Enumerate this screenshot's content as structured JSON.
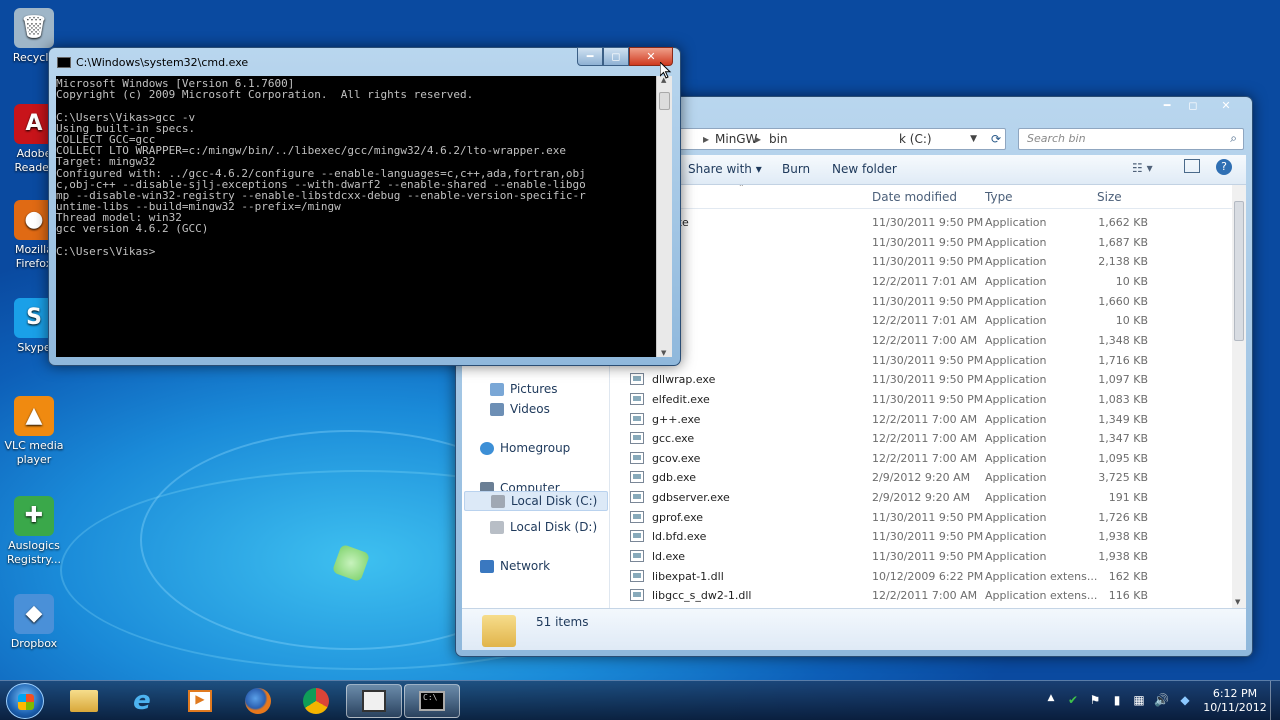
{
  "desktop": {
    "icons": [
      {
        "label": "Recycle",
        "glyph": "🗑",
        "color": "#9fb6c8"
      },
      {
        "label": "Adobe Reader",
        "glyph": "A",
        "color": "#c8141a"
      },
      {
        "label": "Mozilla Firefox",
        "glyph": "●",
        "color": "#e06a14"
      },
      {
        "label": "Skype",
        "glyph": "S",
        "color": "#1aa0e8"
      },
      {
        "label": "VLC media player",
        "glyph": "▲",
        "color": "#f08a10"
      },
      {
        "label": "Auslogics Registry...",
        "glyph": "✚",
        "color": "#3aa84a"
      },
      {
        "label": "Dropbox",
        "glyph": "◆",
        "color": "#4a90d8"
      }
    ]
  },
  "cmd": {
    "title": "C:\\Windows\\system32\\cmd.exe",
    "lines": [
      "Microsoft Windows [Version 6.1.7600]",
      "Copyright (c) 2009 Microsoft Corporation.  All rights reserved.",
      "",
      "C:\\Users\\Vikas>gcc -v",
      "Using built-in specs.",
      "COLLECT_GCC=gcc",
      "COLLECT_LTO_WRAPPER=c:/mingw/bin/../libexec/gcc/mingw32/4.6.2/lto-wrapper.exe",
      "Target: mingw32",
      "Configured with: ../gcc-4.6.2/configure --enable-languages=c,c++,ada,fortran,obj",
      "c,obj-c++ --disable-sjlj-exceptions --with-dwarf2 --enable-shared --enable-libgo",
      "mp --disable-win32-registry --enable-libstdcxx-debug --enable-version-specific-r",
      "untime-libs --build=mingw32 --prefix=/mingw",
      "Thread model: win32",
      "gcc version 4.6.2 (GCC)",
      "",
      "C:\\Users\\Vikas>"
    ]
  },
  "explorer": {
    "address": [
      "k (C:)",
      "MinGW",
      "bin"
    ],
    "search_placeholder": "Search bin",
    "toolbar": {
      "share": "Share with",
      "burn": "Burn",
      "new_folder": "New folder"
    },
    "columns": {
      "date": "Date modified",
      "type": "Type",
      "size": "Size"
    },
    "nav": [
      {
        "label": "Pictures",
        "color": "#7aa7d6"
      },
      {
        "label": "Videos",
        "color": "#6d8fb5"
      },
      {
        "label": "Homegroup",
        "color": "#3d8fd6"
      },
      {
        "label": "Computer",
        "color": "#6b7f95"
      },
      {
        "label": "Local Disk (C:)",
        "color": "#a0a8b3"
      },
      {
        "label": "Local Disk (D:)",
        "color": "#b8bec6"
      },
      {
        "label": "Network",
        "color": "#3a78c0"
      }
    ],
    "files": [
      {
        "name": "ne.exe",
        "date": "11/30/2011 9:50 PM",
        "type": "Application",
        "size": "1,662 KB"
      },
      {
        "name": "",
        "date": "11/30/2011 9:50 PM",
        "type": "Application",
        "size": "1,687 KB"
      },
      {
        "name": "",
        "date": "11/30/2011 9:50 PM",
        "type": "Application",
        "size": "2,138 KB"
      },
      {
        "name": "e",
        "date": "12/2/2011 7:01 AM",
        "type": "Application",
        "size": "10 KB"
      },
      {
        "name": ".exe",
        "date": "11/30/2011 9:50 PM",
        "type": "Application",
        "size": "1,660 KB"
      },
      {
        "name": "",
        "date": "12/2/2011 7:01 AM",
        "type": "Application",
        "size": "10 KB"
      },
      {
        "name": "e",
        "date": "12/2/2011 7:00 AM",
        "type": "Application",
        "size": "1,348 KB"
      },
      {
        "name": ".exe",
        "date": "11/30/2011 9:50 PM",
        "type": "Application",
        "size": "1,716 KB"
      },
      {
        "name": "dllwrap.exe",
        "date": "11/30/2011 9:50 PM",
        "type": "Application",
        "size": "1,097 KB"
      },
      {
        "name": "elfedit.exe",
        "date": "11/30/2011 9:50 PM",
        "type": "Application",
        "size": "1,083 KB"
      },
      {
        "name": "g++.exe",
        "date": "12/2/2011 7:00 AM",
        "type": "Application",
        "size": "1,349 KB"
      },
      {
        "name": "gcc.exe",
        "date": "12/2/2011 7:00 AM",
        "type": "Application",
        "size": "1,347 KB"
      },
      {
        "name": "gcov.exe",
        "date": "12/2/2011 7:00 AM",
        "type": "Application",
        "size": "1,095 KB"
      },
      {
        "name": "gdb.exe",
        "date": "2/9/2012 9:20 AM",
        "type": "Application",
        "size": "3,725 KB"
      },
      {
        "name": "gdbserver.exe",
        "date": "2/9/2012 9:20 AM",
        "type": "Application",
        "size": "191 KB"
      },
      {
        "name": "gprof.exe",
        "date": "11/30/2011 9:50 PM",
        "type": "Application",
        "size": "1,726 KB"
      },
      {
        "name": "ld.bfd.exe",
        "date": "11/30/2011 9:50 PM",
        "type": "Application",
        "size": "1,938 KB"
      },
      {
        "name": "ld.exe",
        "date": "11/30/2011 9:50 PM",
        "type": "Application",
        "size": "1,938 KB"
      },
      {
        "name": "libexpat-1.dll",
        "date": "10/12/2009 6:22 PM",
        "type": "Application extens...",
        "size": "162 KB"
      },
      {
        "name": "libgcc_s_dw2-1.dll",
        "date": "12/2/2011 7:00 AM",
        "type": "Application extens...",
        "size": "116 KB"
      }
    ],
    "status": "51 items"
  },
  "taskbar": {
    "time": "6:12 PM",
    "date": "10/11/2012"
  }
}
